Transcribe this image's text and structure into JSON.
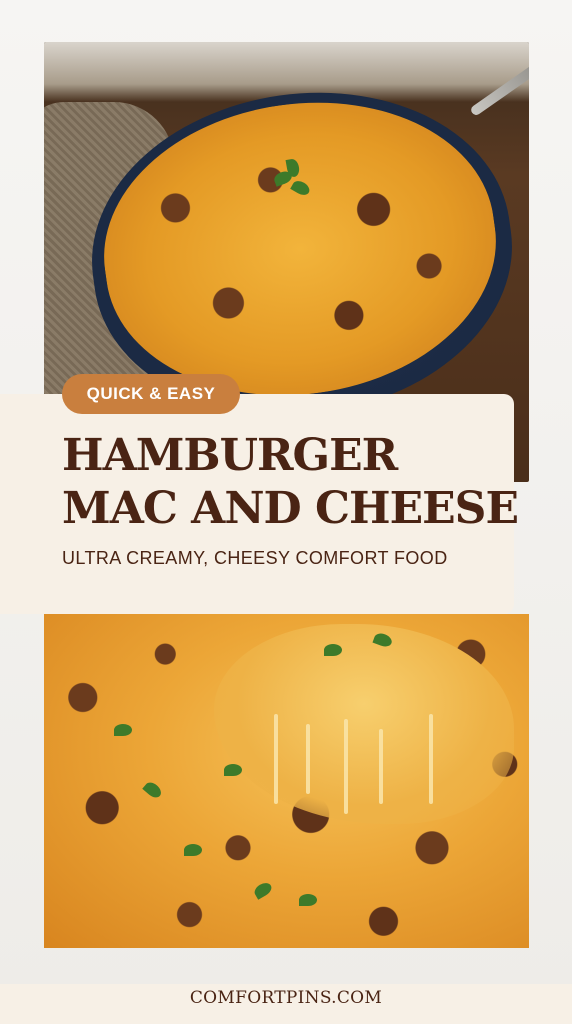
{
  "badge": {
    "label": "QUICK & EASY",
    "color": "#c97f3e"
  },
  "title": {
    "line1": "HAMBURGER",
    "line2": "MAC AND CHEESE",
    "color": "#4a2414"
  },
  "subtitle": "ULTRA CREAMY, CHEESY COMFORT FOOD",
  "footer": {
    "site": "COMFORTPINS.COM"
  },
  "images": {
    "top": "baked-mac-and-cheese-dish-photo",
    "bottom": "cheese-pull-closeup-photo"
  }
}
